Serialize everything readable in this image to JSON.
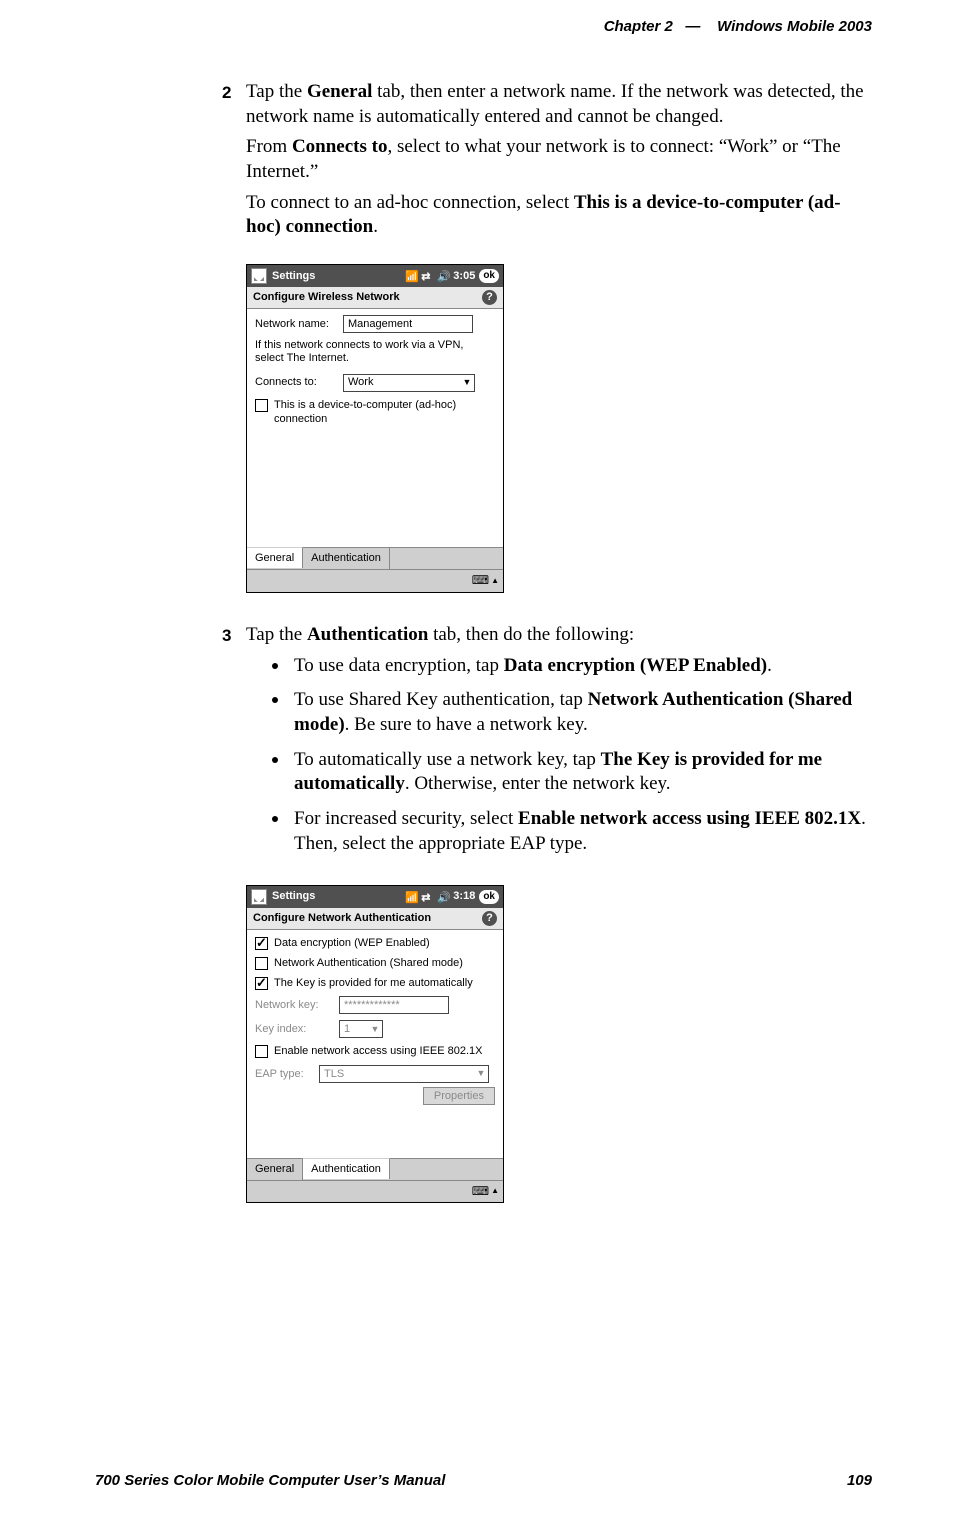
{
  "header": {
    "chapter_label": "Chapter",
    "chapter_num": "2",
    "dash": "—",
    "title": "Windows Mobile 2003"
  },
  "step2": {
    "num": "2",
    "p1_a": "Tap the ",
    "p1_b": "General",
    "p1_c": " tab, then enter a network name. If the network was detected, the network name is automatically entered and cannot be changed.",
    "p2_a": "From ",
    "p2_b": "Connects to",
    "p2_c": ", select to what your network is to connect: “Work” or “The Internet.”",
    "p3_a": "To connect to an ad-hoc connection, select ",
    "p3_b": "This is a device-to-computer (ad-hoc) connection",
    "p3_c": "."
  },
  "mock1": {
    "title": "Settings",
    "time": "3:05",
    "ok": "ok",
    "subtitle": "Configure Wireless Network",
    "netname_label": "Network name:",
    "netname_value": "Management",
    "hint": "If this network connects to work via a VPN, select The Internet.",
    "connects_label": "Connects to:",
    "connects_value": "Work",
    "adhoc_label": "This is a device-to-computer (ad-hoc) connection",
    "tab_general": "General",
    "tab_auth": "Authentication"
  },
  "step3": {
    "num": "3",
    "p_a": "Tap the ",
    "p_b": "Authentication",
    "p_c": " tab, then do the following:",
    "b1_a": "To use data encryption, tap ",
    "b1_b": "Data encryption (WEP Enabled)",
    "b1_c": ".",
    "b2_a": "To use Shared Key authentication, tap ",
    "b2_b": "Network Authentication (Shared mode)",
    "b2_c": ". Be sure to have a network key.",
    "b3_a": "To automatically use a network key, tap ",
    "b3_b": "The Key is provided for me automatically",
    "b3_c": ". Otherwise, enter the network key.",
    "b4_a": "For increased security, select ",
    "b4_b": "Enable network access using IEEE 802.1X",
    "b4_c": ". Then, select the appropriate EAP type."
  },
  "mock2": {
    "title": "Settings",
    "time": "3:18",
    "ok": "ok",
    "subtitle": "Configure Network Authentication",
    "chk_wep": "Data encryption (WEP Enabled)",
    "chk_shared": "Network Authentication (Shared mode)",
    "chk_auto": "The Key is provided for me automatically",
    "netkey_label": "Network key:",
    "netkey_value": "*************",
    "keyidx_label": "Key index:",
    "keyidx_value": "1",
    "chk_8021x": "Enable network access using IEEE 802.1X",
    "eap_label": "EAP type:",
    "eap_value": "TLS",
    "properties_btn": "Properties",
    "tab_general": "General",
    "tab_auth": "Authentication"
  },
  "footer": {
    "left": "700 Series Color Mobile Computer User’s Manual",
    "right": "109"
  }
}
